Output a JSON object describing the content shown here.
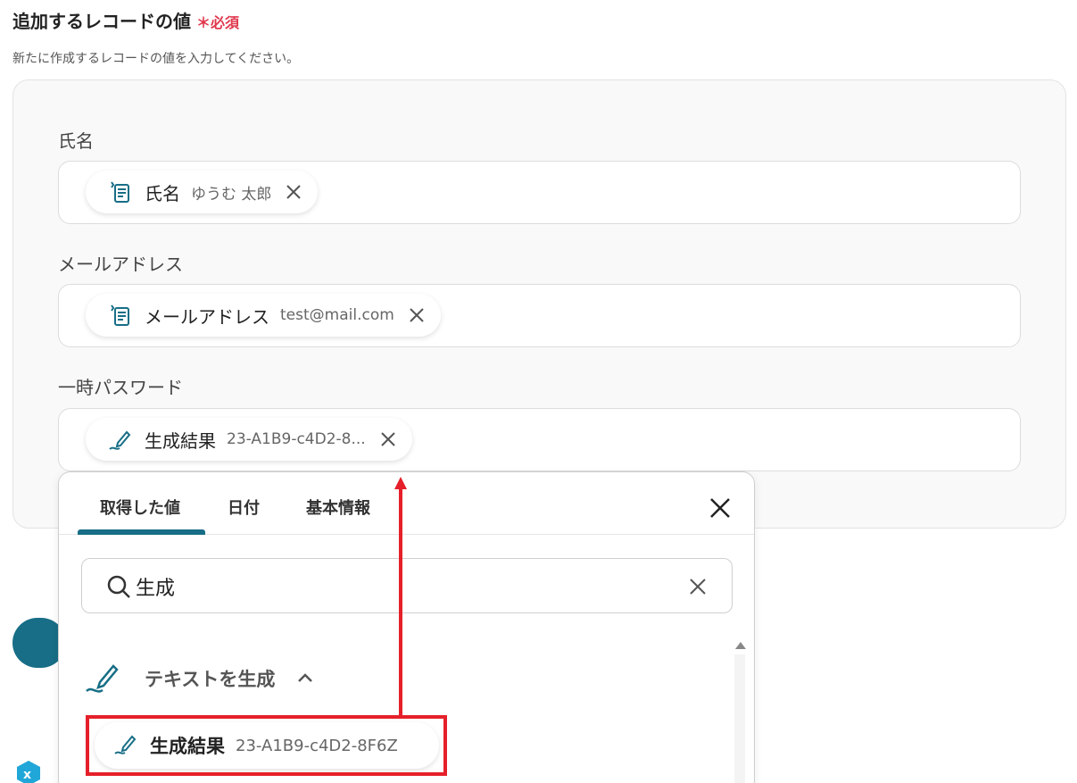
{
  "section": {
    "title": "追加するレコードの値",
    "required_mark": "＊必須",
    "description": "新たに作成するレコードの値を入力してください。"
  },
  "fields": [
    {
      "label": "氏名",
      "chip_name": "氏名",
      "chip_value": "ゆうむ 太郎",
      "icon": "form-record-icon"
    },
    {
      "label": "メールアドレス",
      "chip_name": "メールアドレス",
      "chip_value": "test@mail.com",
      "icon": "form-record-icon"
    },
    {
      "label": "一時パスワード",
      "chip_name": "生成結果",
      "chip_value": "23-A1B9-c4D2-8...",
      "icon": "pen-icon"
    }
  ],
  "popup": {
    "tabs": [
      "取得した値",
      "日付",
      "基本情報"
    ],
    "active_tab": 0,
    "search_value": "生成",
    "group_title": "テキストを生成",
    "result_name": "生成結果",
    "result_value": "23-A1B9-c4D2-8F6Z"
  },
  "background": {
    "logo_icon": "x-logo-icon"
  },
  "colors": {
    "accent": "#176e86",
    "required": "#e0384e",
    "annotation": "#e5202a"
  }
}
